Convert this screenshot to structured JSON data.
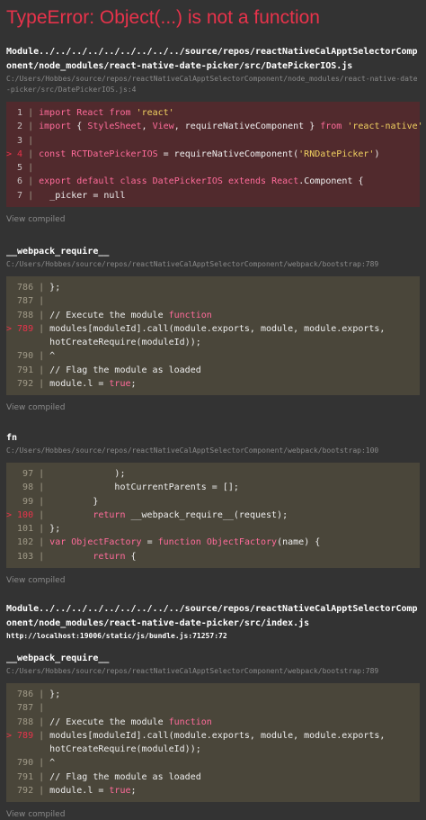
{
  "error_title": "TypeError: Object(...) is not a function",
  "view_compiled": "View compiled",
  "frames": [
    {
      "name": "Module../../../../../../../../../source/repos/reactNativeCalApptSelectorComponent/node_modules/react-native-date-picker/src/DatePickerIOS.js",
      "path": "C:/Users/Hobbes/source/repos/reactNativeCalApptSelectorComponent/node_modules/react-native-date-picker/src/DatePickerIOS.js:4",
      "style": "err",
      "lines": [
        {
          "num": "1",
          "hl": false,
          "code": "import React from 'react'"
        },
        {
          "num": "2",
          "hl": false,
          "code": "import { StyleSheet, View, requireNativeComponent } from 'react-native'"
        },
        {
          "num": "3",
          "hl": false,
          "code": ""
        },
        {
          "num": "4",
          "hl": true,
          "code": "const RCTDatePickerIOS = requireNativeComponent('RNDatePicker')"
        },
        {
          "num": "5",
          "hl": false,
          "code": ""
        },
        {
          "num": "6",
          "hl": false,
          "code": "export default class DatePickerIOS extends React.Component {"
        },
        {
          "num": "7",
          "hl": false,
          "code": "  _picker = null"
        }
      ]
    },
    {
      "name": "__webpack_require__",
      "path": "C:/Users/Hobbes/source/repos/reactNativeCalApptSelectorComponent/webpack/bootstrap:789",
      "style": "norm",
      "lines": [
        {
          "num": "786",
          "hl": false,
          "code": "};"
        },
        {
          "num": "787",
          "hl": false,
          "code": ""
        },
        {
          "num": "788",
          "hl": false,
          "code": "// Execute the module function"
        },
        {
          "num": "789",
          "hl": true,
          "code": "modules[moduleId].call(module.exports, module, module.exports,"
        },
        {
          "num": "",
          "hl": false,
          "code": "hotCreateRequire(moduleId));"
        },
        {
          "num": "790",
          "hl": false,
          "code": "^"
        },
        {
          "num": "791",
          "hl": false,
          "code": "// Flag the module as loaded"
        },
        {
          "num": "792",
          "hl": false,
          "code": "module.l = true;"
        }
      ]
    },
    {
      "name": "fn",
      "path": "C:/Users/Hobbes/source/repos/reactNativeCalApptSelectorComponent/webpack/bootstrap:100",
      "style": "norm",
      "lines": [
        {
          "num": "97",
          "hl": false,
          "code": "            );"
        },
        {
          "num": "98",
          "hl": false,
          "code": "            hotCurrentParents = [];"
        },
        {
          "num": "99",
          "hl": false,
          "code": "        }"
        },
        {
          "num": "100",
          "hl": true,
          "code": "        return __webpack_require__(request);"
        },
        {
          "num": "101",
          "hl": false,
          "code": "};"
        },
        {
          "num": "102",
          "hl": false,
          "code": "var ObjectFactory = function ObjectFactory(name) {"
        },
        {
          "num": "103",
          "hl": false,
          "code": "        return {"
        }
      ]
    },
    {
      "name": "Module../../../../../../../../../source/repos/reactNativeCalApptSelectorComponent/node_modules/react-native-date-picker/src/index.js",
      "path": "http://localhost:19006/static/js/bundle.js:71257:72",
      "style": "none",
      "lines": []
    },
    {
      "name": "__webpack_require__",
      "path": "C:/Users/Hobbes/source/repos/reactNativeCalApptSelectorComponent/webpack/bootstrap:789",
      "style": "norm",
      "lines": [
        {
          "num": "786",
          "hl": false,
          "code": "};"
        },
        {
          "num": "787",
          "hl": false,
          "code": ""
        },
        {
          "num": "788",
          "hl": false,
          "code": "// Execute the module function"
        },
        {
          "num": "789",
          "hl": true,
          "code": "modules[moduleId].call(module.exports, module, module.exports,"
        },
        {
          "num": "",
          "hl": false,
          "code": "hotCreateRequire(moduleId));"
        },
        {
          "num": "790",
          "hl": false,
          "code": "^"
        },
        {
          "num": "791",
          "hl": false,
          "code": "// Flag the module as loaded"
        },
        {
          "num": "792",
          "hl": false,
          "code": "module.l = true;"
        }
      ]
    }
  ]
}
